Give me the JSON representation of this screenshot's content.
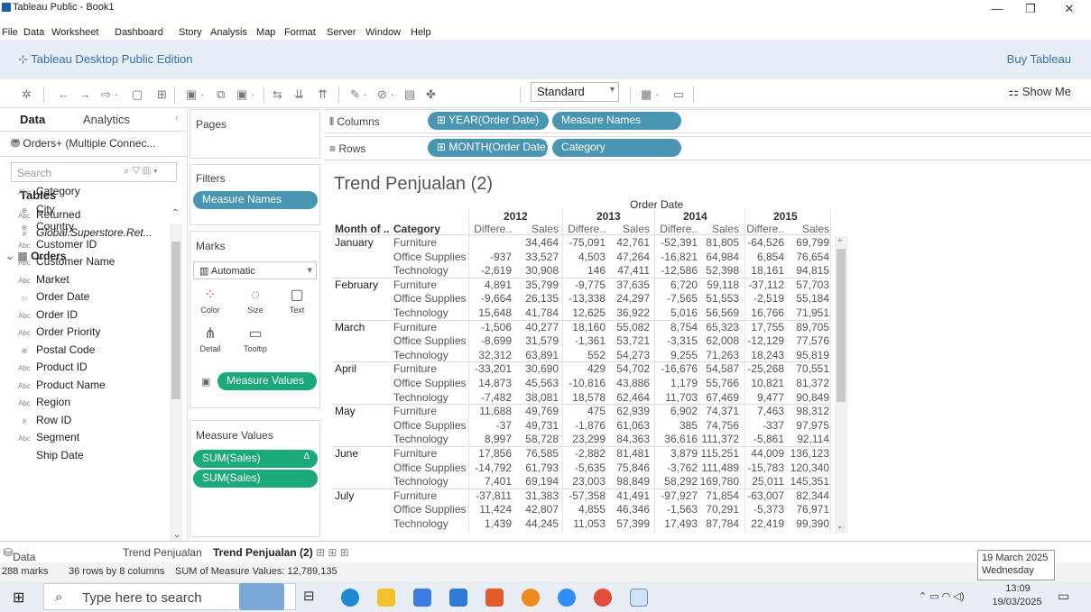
{
  "window": {
    "title": "Tableau Public - Book1"
  },
  "menu": [
    "File",
    "Data",
    "Worksheet",
    "Dashboard",
    "Story",
    "Analysis",
    "Map",
    "Format",
    "Server",
    "Window",
    "Help"
  ],
  "banner": {
    "edition": "Tableau Desktop Public Edition",
    "buy": "Buy Tableau"
  },
  "toolbar": {
    "fit": "Standard",
    "show_me": "Show Me"
  },
  "datapane": {
    "tab_data": "Data",
    "tab_analytics": "Analytics",
    "datasource": "Orders+ (Multiple Connec...",
    "search_placeholder": "Search",
    "tables_heading": "Tables",
    "tables": [
      {
        "icon": "Abc",
        "name": "Returned"
      },
      {
        "icon": "#",
        "name": "Global.Superstore.Ret..."
      }
    ],
    "orders_heading": "Orders",
    "fields": [
      {
        "icon": "Abc",
        "name": "Category"
      },
      {
        "icon": "⊕",
        "name": "City"
      },
      {
        "icon": "⊕",
        "name": "Country"
      },
      {
        "icon": "Abc",
        "name": "Customer ID"
      },
      {
        "icon": "Abc",
        "name": "Customer Name"
      },
      {
        "icon": "Abc",
        "name": "Market"
      },
      {
        "icon": "▭",
        "name": "Order Date"
      },
      {
        "icon": "Abc",
        "name": "Order ID"
      },
      {
        "icon": "Abc",
        "name": "Order Priority"
      },
      {
        "icon": "⊕",
        "name": "Postal Code"
      },
      {
        "icon": "Abc",
        "name": "Product ID"
      },
      {
        "icon": "Abc",
        "name": "Product Name"
      },
      {
        "icon": "Abc",
        "name": "Region"
      },
      {
        "icon": "#",
        "name": "Row ID"
      },
      {
        "icon": "Abc",
        "name": "Segment"
      },
      {
        "icon": "",
        "name": "Ship Date"
      }
    ]
  },
  "shelves": {
    "pages": "Pages",
    "filters": "Filters",
    "filter_pill": "Measure Names",
    "marks": "Marks",
    "mark_type": "Automatic",
    "mark_buttons": [
      "Color",
      "Size",
      "Text",
      "Detail",
      "Tooltip"
    ],
    "measure_values_pill": "Measure Values",
    "measure_values_card": "Measure Values",
    "mv_items": [
      "SUM(Sales)",
      "SUM(Sales)"
    ],
    "columns_label": "Columns",
    "columns_pills": [
      "YEAR(Order Date)",
      "Measure Names"
    ],
    "rows_label": "Rows",
    "rows_pills": [
      "MONTH(Order Date)",
      "Category"
    ]
  },
  "view": {
    "title": "Trend Penjualan (2)",
    "column_header": "Order Date",
    "row_headers": [
      "Month of ..",
      "Category"
    ],
    "years": [
      "2012",
      "2013",
      "2014",
      "2015"
    ],
    "measures": [
      "Differe..",
      "Sales"
    ],
    "months": [
      "January",
      "February",
      "March",
      "April",
      "May",
      "June",
      "July"
    ],
    "categories": [
      "Furniture",
      "Office Supplies",
      "Technology"
    ],
    "rows": [
      [
        "",
        "34,464",
        "-75,091",
        "42,761",
        "-52,391",
        "81,805",
        "-64,526",
        "69,799"
      ],
      [
        "-937",
        "33,527",
        "4,503",
        "47,264",
        "-16,821",
        "64,984",
        "6,854",
        "76,654"
      ],
      [
        "-2,619",
        "30,908",
        "146",
        "47,411",
        "-12,586",
        "52,398",
        "18,161",
        "94,815"
      ],
      [
        "4,891",
        "35,799",
        "-9,775",
        "37,635",
        "6,720",
        "59,118",
        "-37,112",
        "57,703"
      ],
      [
        "-9,664",
        "26,135",
        "-13,338",
        "24,297",
        "-7,565",
        "51,553",
        "-2,519",
        "55,184"
      ],
      [
        "15,648",
        "41,784",
        "12,625",
        "36,922",
        "5,016",
        "56,569",
        "16,766",
        "71,951"
      ],
      [
        "-1,506",
        "40,277",
        "18,160",
        "55,082",
        "8,754",
        "65,323",
        "17,755",
        "89,705"
      ],
      [
        "-8,699",
        "31,579",
        "-1,361",
        "53,721",
        "-3,315",
        "62,008",
        "-12,129",
        "77,576"
      ],
      [
        "32,312",
        "63,891",
        "552",
        "54,273",
        "9,255",
        "71,263",
        "18,243",
        "95,819"
      ],
      [
        "-33,201",
        "30,690",
        "429",
        "54,702",
        "-16,676",
        "54,587",
        "-25,268",
        "70,551"
      ],
      [
        "14,873",
        "45,563",
        "-10,816",
        "43,886",
        "1,179",
        "55,766",
        "10,821",
        "81,372"
      ],
      [
        "-7,482",
        "38,081",
        "18,578",
        "62,464",
        "11,703",
        "67,469",
        "9,477",
        "90,849"
      ],
      [
        "11,688",
        "49,769",
        "475",
        "62,939",
        "6,902",
        "74,371",
        "7,463",
        "98,312"
      ],
      [
        "-37",
        "49,731",
        "-1,876",
        "61,063",
        "385",
        "74,756",
        "-337",
        "97,975"
      ],
      [
        "8,997",
        "58,728",
        "23,299",
        "84,363",
        "36,616",
        "111,372",
        "-5,861",
        "92,114"
      ],
      [
        "17,856",
        "76,585",
        "-2,882",
        "81,481",
        "3,879",
        "115,251",
        "44,009",
        "136,123"
      ],
      [
        "-14,792",
        "61,793",
        "-5,635",
        "75,846",
        "-3,762",
        "111,489",
        "-15,783",
        "120,340"
      ],
      [
        "7,401",
        "69,194",
        "23,003",
        "98,849",
        "58,292",
        "169,780",
        "25,011",
        "145,351"
      ],
      [
        "-37,811",
        "31,383",
        "-57,358",
        "41,491",
        "-97,927",
        "71,854",
        "-63,007",
        "82,344"
      ],
      [
        "11,424",
        "42,807",
        "4,855",
        "46,346",
        "-1,563",
        "70,291",
        "-5,373",
        "76,971"
      ],
      [
        "1,439",
        "44,245",
        "11,053",
        "57,399",
        "17,493",
        "87,784",
        "22,419",
        "99,390"
      ]
    ]
  },
  "sheettabs": {
    "datasource": "Data Source",
    "tabs": [
      "Trend Penjualan",
      "Trend Penjualan (2)"
    ]
  },
  "status": {
    "marks": "288 marks",
    "dims": "36 rows by 8 columns",
    "sum": "SUM of Measure Values: 12,789,135"
  },
  "taskbar": {
    "search": "Type here to search",
    "time": "13:09",
    "date": "19/03/2025"
  },
  "datepopup": {
    "line1": "19 March 2025",
    "line2": "Wednesday"
  }
}
